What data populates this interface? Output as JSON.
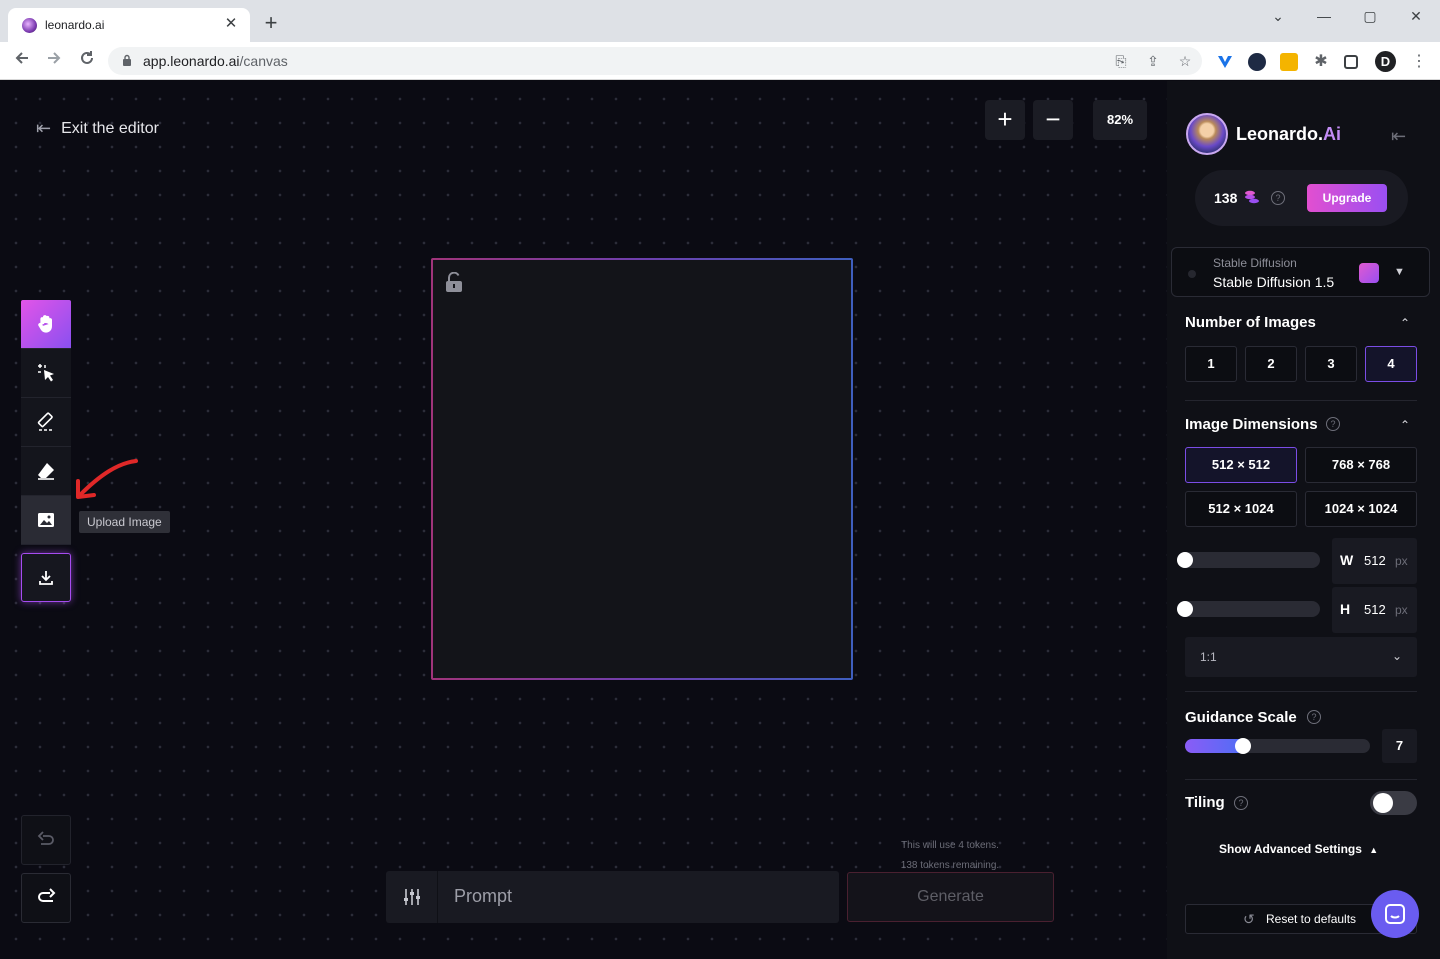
{
  "browser": {
    "tab_title": "leonardo.ai",
    "tab_close": "✕",
    "new_tab": "+",
    "url_host": "app.leonardo.ai",
    "url_path": "/canvas",
    "window_controls": [
      "⌄",
      "—",
      "▢",
      "✕"
    ],
    "profile_initial": "D"
  },
  "editor": {
    "exit_label": "Exit the editor",
    "zoom_in": "+",
    "zoom_out": "−",
    "zoom_level": "82%",
    "tools": [
      "pan-tool",
      "select-tool",
      "draw-mask-tool",
      "eraser-tool",
      "upload-image-tool",
      "download-tool"
    ],
    "tooltip": "Upload Image",
    "tokens_note_line1": "This will use 4 tokens.",
    "tokens_note_line2": "138 tokens remaining.",
    "prompt_placeholder": "Prompt",
    "generate_label": "Generate"
  },
  "panel": {
    "brand": "Leonardo.",
    "brand_suffix": "Ai",
    "token_count": "138",
    "upgrade_label": "Upgrade",
    "model_category": "Stable Diffusion",
    "model_name": "Stable Diffusion 1.5",
    "num_images_title": "Number of Images",
    "num_images_options": [
      "1",
      "2",
      "3",
      "4"
    ],
    "num_images_selected": "4",
    "dimensions_title": "Image Dimensions",
    "dimension_options": [
      "512 × 512",
      "768 × 768",
      "512 × 1024",
      "1024 × 1024"
    ],
    "dimension_selected": "512 × 512",
    "width_label": "W",
    "width_value": "512",
    "height_label": "H",
    "height_value": "512",
    "unit": "px",
    "aspect_ratio": "1:1",
    "guidance_title": "Guidance Scale",
    "guidance_value": "7",
    "guidance_level": 0.3,
    "tiling_title": "Tiling",
    "tiling_on": false,
    "advanced_label": "Show Advanced Settings",
    "reset_label": "Reset to defaults"
  },
  "colors": {
    "accent_pink": "#e24fd0",
    "accent_purple": "#9a4ff2",
    "canvas_bg": "#0b0b13",
    "panel_bg": "#0f1016"
  }
}
